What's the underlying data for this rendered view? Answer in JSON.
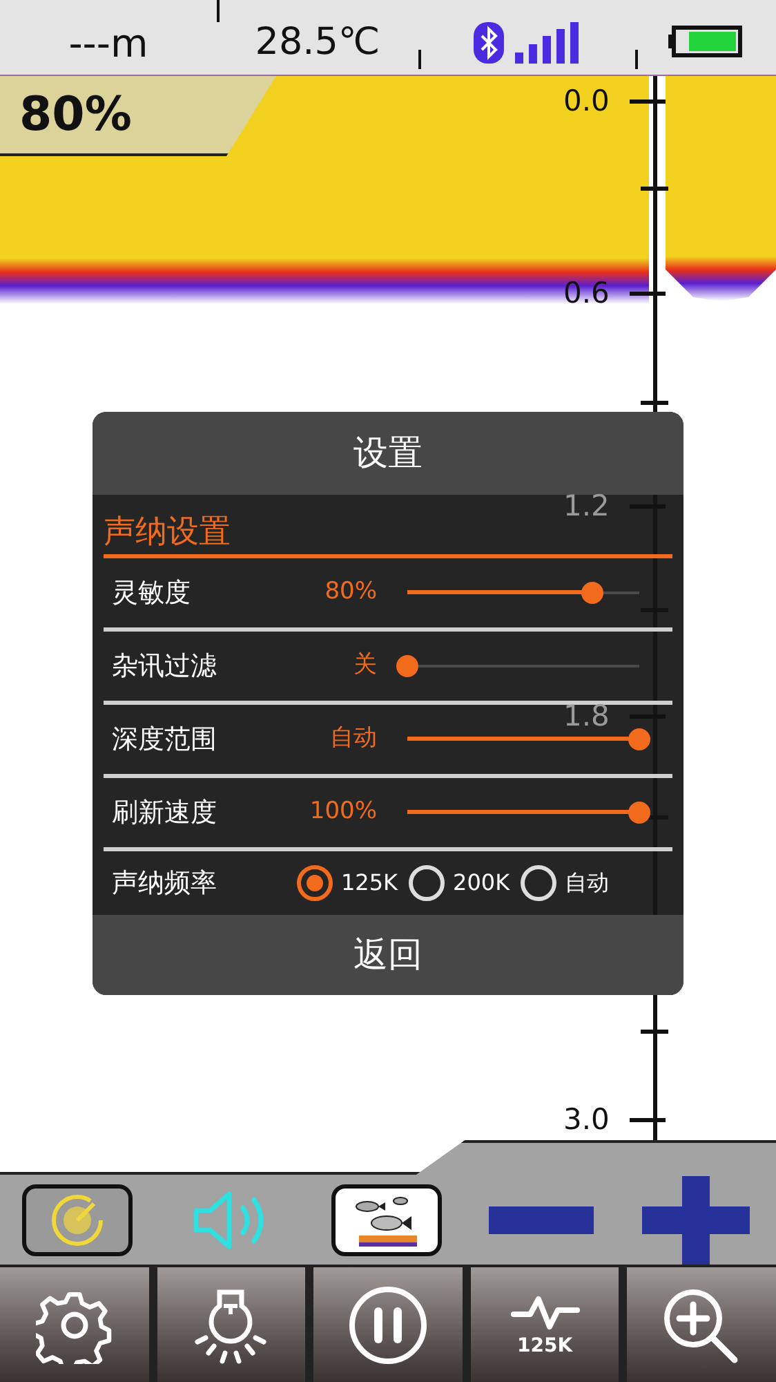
{
  "status_bar": {
    "depth": "---m",
    "temperature": "28.5℃"
  },
  "sensitivity_badge": "80%",
  "depth_scale": [
    "0.0",
    "0.6",
    "1.2",
    "1.8",
    "3.0"
  ],
  "dialog": {
    "title": "设置",
    "section": "声纳设置",
    "rows": [
      {
        "kind": "slider",
        "label": "灵敏度",
        "value": "80%",
        "level": 0.8
      },
      {
        "kind": "slider",
        "label": "杂讯过滤",
        "value": "关",
        "level": 0
      },
      {
        "kind": "slider",
        "label": "深度范围",
        "value": "自动",
        "level": 1
      },
      {
        "kind": "slider",
        "label": "刷新速度",
        "value": "100%",
        "level": 1
      },
      {
        "kind": "radio",
        "label": "声纳频率",
        "options": [
          {
            "label": "125K",
            "selected": true
          },
          {
            "label": "200K",
            "selected": false
          },
          {
            "label": "自动",
            "selected": false
          }
        ]
      }
    ],
    "back_button": "返回"
  },
  "mode_bar": [
    {
      "kind": "gauge",
      "selected": true
    },
    {
      "kind": "speaker",
      "selected": false
    },
    {
      "kind": "fish",
      "selected": true
    },
    {
      "kind": "minus",
      "selected": false
    },
    {
      "kind": "plus",
      "selected": false
    }
  ],
  "toolbar": [
    {
      "kind": "settings"
    },
    {
      "kind": "light"
    },
    {
      "kind": "pause"
    },
    {
      "kind": "frequency",
      "label": "125K"
    },
    {
      "kind": "zoom"
    }
  ]
}
